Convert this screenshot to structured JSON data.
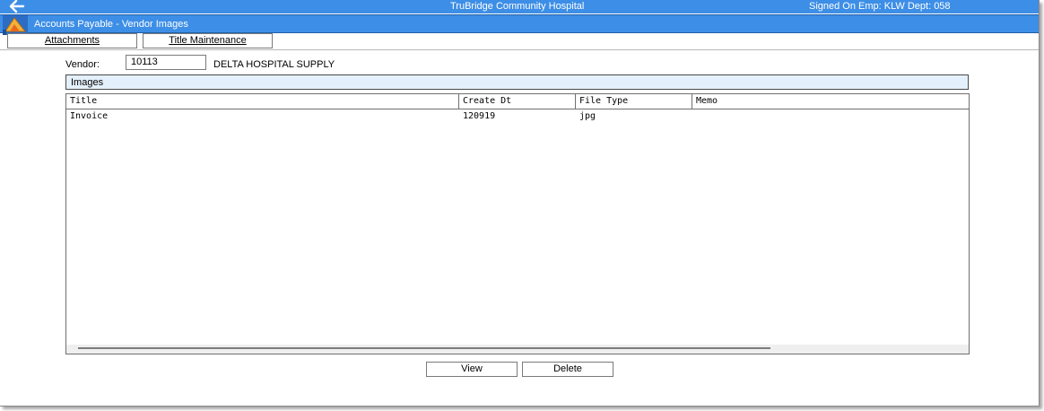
{
  "topbar": {
    "hospital": "TruBridge Community Hospital",
    "signon": "Signed On Emp: KLW  Dept: 058"
  },
  "header": {
    "title": "Accounts Payable - Vendor Images"
  },
  "toolbar": {
    "attachments_label": "Attachments",
    "title_maintenance_label": "Title Maintenance"
  },
  "vendor": {
    "label": "Vendor:",
    "number": "10113",
    "name": "DELTA HOSPITAL SUPPLY"
  },
  "images": {
    "section_label": "Images",
    "columns": [
      "Title",
      "Create Dt",
      "File Type",
      "Memo"
    ],
    "rows": [
      {
        "title": "Invoice",
        "create_dt": "120919",
        "file_type": "jpg",
        "memo": ""
      }
    ]
  },
  "buttons": {
    "view": "View",
    "delete": "Delete"
  },
  "colors": {
    "header_blue": "#3d8ee6",
    "section_bg": "#e4f0fb"
  },
  "icons": {
    "back": "back-arrow-icon",
    "logo": "app-logo-icon"
  }
}
